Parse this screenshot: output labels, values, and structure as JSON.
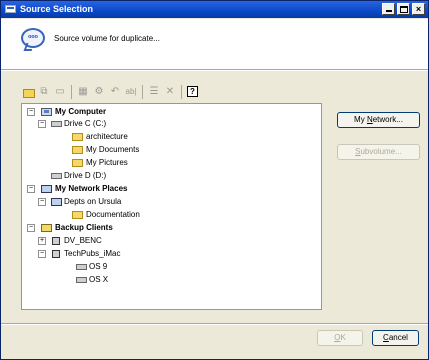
{
  "window": {
    "title": "Source Selection"
  },
  "header": {
    "prompt": "Source volume for duplicate..."
  },
  "toolbar": {
    "tools": [
      "new-folder",
      "copy",
      "move",
      "properties",
      "settings",
      "undo",
      "rename",
      "filter",
      "delete",
      "help"
    ],
    "help_label": "?"
  },
  "tree": {
    "my_computer": "My Computer",
    "drive_c": "Drive C (C:)",
    "architecture": "architecture",
    "my_documents": "My Documents",
    "my_pictures": "My Pictures",
    "drive_d": "Drive D (D:)",
    "network_places": "My Network Places",
    "depts_ursula": "Depts on Ursula",
    "documentation": "Documentation",
    "backup_clients": "Backup Clients",
    "dv_benc": "DV_BENC",
    "techpubs_imac": "TechPubs_iMac",
    "os9": "OS 9",
    "osx": "OS X",
    "collapse_symbol": "−",
    "expand_symbol": "+"
  },
  "buttons": {
    "my_network_prefix": "My ",
    "my_network_mnemonic": "N",
    "my_network_suffix": "etwork...",
    "subvolume_mnemonic": "S",
    "subvolume_suffix": "ubvolume...",
    "ok_mnemonic": "O",
    "ok_suffix": "K",
    "cancel_mnemonic": "C",
    "cancel_suffix": "ancel"
  }
}
